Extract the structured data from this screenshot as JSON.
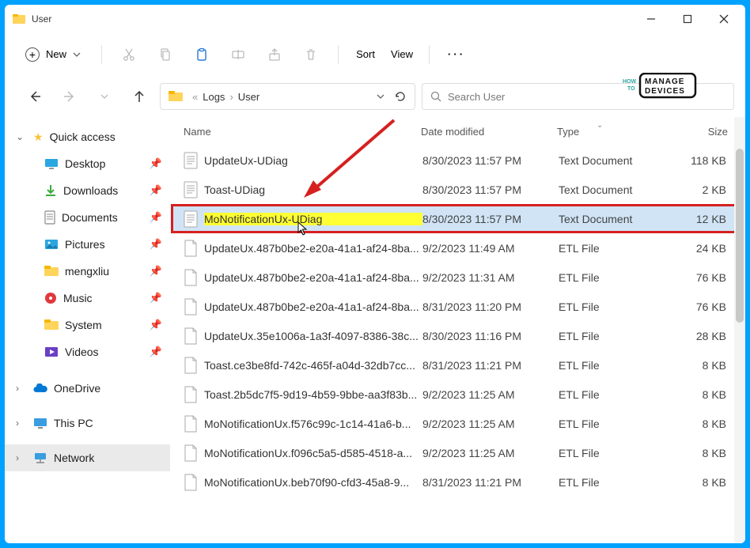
{
  "window": {
    "title": "User"
  },
  "toolbar": {
    "new_label": "New",
    "sort_label": "Sort",
    "view_label": "View"
  },
  "breadcrumb": {
    "prefix": "«",
    "items": [
      "Logs",
      "User"
    ]
  },
  "search": {
    "placeholder": "Search User"
  },
  "watermark": {
    "how": "HOW",
    "to": "TO",
    "manage": "MANAGE",
    "devices": "DEVICES"
  },
  "sidebar": {
    "quick_access": "Quick access",
    "pins": [
      {
        "label": "Desktop",
        "icon": "desktop"
      },
      {
        "label": "Downloads",
        "icon": "downloads"
      },
      {
        "label": "Documents",
        "icon": "documents"
      },
      {
        "label": "Pictures",
        "icon": "pictures"
      },
      {
        "label": "mengxliu",
        "icon": "folder"
      },
      {
        "label": "Music",
        "icon": "music"
      },
      {
        "label": "System",
        "icon": "folder"
      },
      {
        "label": "Videos",
        "icon": "videos"
      }
    ],
    "onedrive": "OneDrive",
    "thispc": "This PC",
    "network": "Network"
  },
  "columns": {
    "name": "Name",
    "date": "Date modified",
    "type": "Type",
    "size": "Size"
  },
  "files": [
    {
      "name": "UpdateUx-UDiag",
      "date": "8/30/2023 11:57 PM",
      "type": "Text Document",
      "size": "118 KB",
      "icon": "txt"
    },
    {
      "name": "Toast-UDiag",
      "date": "8/30/2023 11:57 PM",
      "type": "Text Document",
      "size": "2 KB",
      "icon": "txt"
    },
    {
      "name": "MoNotificationUx-UDiag",
      "date": "8/30/2023 11:57 PM",
      "type": "Text Document",
      "size": "12 KB",
      "icon": "txt",
      "selected": true,
      "highlighted": true
    },
    {
      "name": "UpdateUx.487b0be2-e20a-41a1-af24-8ba...",
      "date": "9/2/2023 11:49 AM",
      "type": "ETL File",
      "size": "24 KB",
      "icon": "file"
    },
    {
      "name": "UpdateUx.487b0be2-e20a-41a1-af24-8ba...",
      "date": "9/2/2023 11:31 AM",
      "type": "ETL File",
      "size": "76 KB",
      "icon": "file"
    },
    {
      "name": "UpdateUx.487b0be2-e20a-41a1-af24-8ba...",
      "date": "8/31/2023 11:20 PM",
      "type": "ETL File",
      "size": "76 KB",
      "icon": "file"
    },
    {
      "name": "UpdateUx.35e1006a-1a3f-4097-8386-38c...",
      "date": "8/30/2023 11:16 PM",
      "type": "ETL File",
      "size": "28 KB",
      "icon": "file"
    },
    {
      "name": "Toast.ce3be8fd-742c-465f-a04d-32db7cc...",
      "date": "8/31/2023 11:21 PM",
      "type": "ETL File",
      "size": "8 KB",
      "icon": "file"
    },
    {
      "name": "Toast.2b5dc7f5-9d19-4b59-9bbe-aa3f83b...",
      "date": "9/2/2023 11:25 AM",
      "type": "ETL File",
      "size": "8 KB",
      "icon": "file"
    },
    {
      "name": "MoNotificationUx.f576c99c-1c14-41a6-b...",
      "date": "9/2/2023 11:25 AM",
      "type": "ETL File",
      "size": "8 KB",
      "icon": "file"
    },
    {
      "name": "MoNotificationUx.f096c5a5-d585-4518-a...",
      "date": "9/2/2023 11:25 AM",
      "type": "ETL File",
      "size": "8 KB",
      "icon": "file"
    },
    {
      "name": "MoNotificationUx.beb70f90-cfd3-45a8-9...",
      "date": "8/31/2023 11:21 PM",
      "type": "ETL File",
      "size": "8 KB",
      "icon": "file"
    }
  ]
}
